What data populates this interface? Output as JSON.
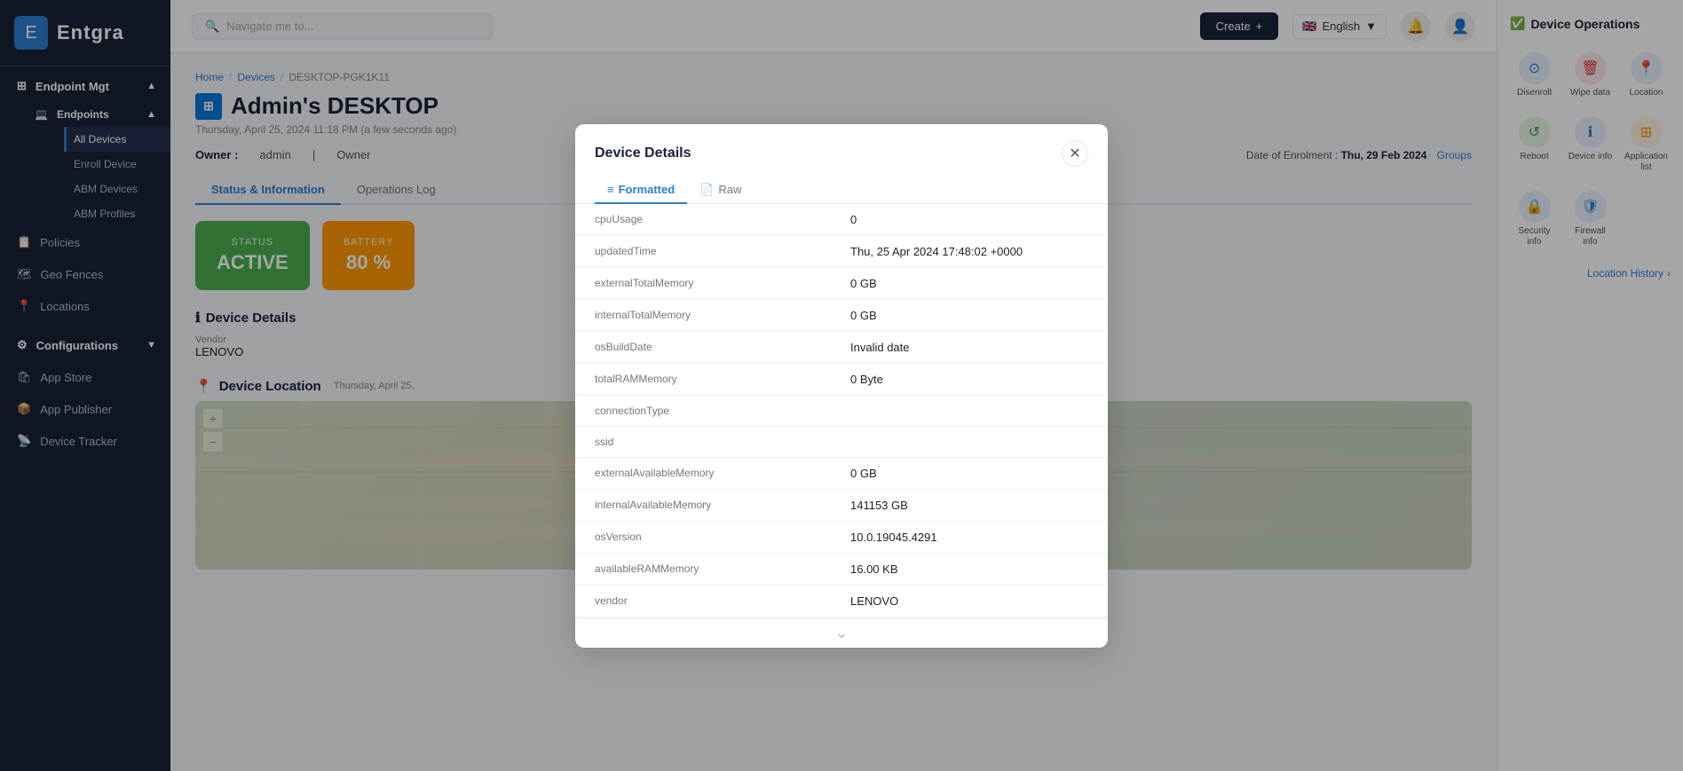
{
  "app": {
    "name": "Entgra"
  },
  "topbar": {
    "search_placeholder": "Navigate me to...",
    "create_label": "Create",
    "language": "English",
    "lang_flag": "🇬🇧"
  },
  "breadcrumb": {
    "home": "Home",
    "devices": "Devices",
    "current": "DESKTOP-PGK1K11"
  },
  "page": {
    "title": "Admin's DESKTOP",
    "subtitle": "Thursday, April 25, 2024 11:18 PM (a few seconds ago)",
    "owner_label": "Owner :",
    "owner_value": "admin",
    "owner_type_label": "Owner",
    "enroll_label": "Date of Enrolment :",
    "enroll_value": "Thu, 29 Feb 2024",
    "groups_label": "Groups"
  },
  "tabs": [
    {
      "label": "Status & Information",
      "active": true
    },
    {
      "label": "Operations Log",
      "active": false
    }
  ],
  "status_cards": [
    {
      "label": "Status",
      "value": "ACTIVE",
      "type": "active"
    },
    {
      "label": "Battery",
      "value": "80 %",
      "type": "battery"
    }
  ],
  "device_details": {
    "section_title": "Device Details",
    "fields": [
      {
        "label": "Vendor",
        "value": "LENOVO"
      }
    ]
  },
  "device_location": {
    "section_title": "Device Location",
    "timestamp": "Thursday, April 25,",
    "history_link": "Location History"
  },
  "device_operations": {
    "title": "Device Operations",
    "operations": [
      {
        "id": "disenroll",
        "label": "Disenroll",
        "icon": "⊙",
        "class": "op-disenroll"
      },
      {
        "id": "wipe",
        "label": "Wipe data",
        "icon": "🗑",
        "class": "op-wipe"
      },
      {
        "id": "location",
        "label": "Location",
        "icon": "📍",
        "class": "op-location"
      },
      {
        "id": "reboot",
        "label": "Reboot",
        "icon": "↺",
        "class": "op-reboot"
      },
      {
        "id": "devinfo",
        "label": "Device info",
        "icon": "ℹ",
        "class": "op-devinfo"
      },
      {
        "id": "applist",
        "label": "Application list",
        "icon": "⊞",
        "class": "op-applist"
      },
      {
        "id": "secinfo",
        "label": "Security info",
        "icon": "🔒",
        "class": "op-secinfo"
      },
      {
        "id": "firewall",
        "label": "Firewall info",
        "icon": "🛡",
        "class": "op-firewall"
      }
    ]
  },
  "sidebar": {
    "logo": "Entgra",
    "items": [
      {
        "id": "endpoint-mgt",
        "label": "Endpoint Mgt",
        "icon": "⊞",
        "expanded": true,
        "type": "section"
      },
      {
        "id": "endpoints",
        "label": "Endpoints",
        "icon": "💻",
        "expanded": true,
        "type": "subsection"
      },
      {
        "id": "all-devices",
        "label": "All Devices",
        "icon": "",
        "type": "sub"
      },
      {
        "id": "enroll-device",
        "label": "Enroll Device",
        "icon": "",
        "type": "sub"
      },
      {
        "id": "abm-devices",
        "label": "ABM Devices",
        "icon": "",
        "type": "sub"
      },
      {
        "id": "abm-profiles",
        "label": "ABM Profiles",
        "icon": "",
        "type": "sub"
      },
      {
        "id": "policies",
        "label": "Policies",
        "icon": "📋",
        "type": "main"
      },
      {
        "id": "geo-fences",
        "label": "Geo Fences",
        "icon": "🗺",
        "type": "main"
      },
      {
        "id": "locations",
        "label": "Locations",
        "icon": "📍",
        "type": "main"
      },
      {
        "id": "configurations",
        "label": "Configurations",
        "icon": "⚙",
        "type": "section"
      },
      {
        "id": "app-store",
        "label": "App Store",
        "icon": "🛍",
        "type": "main"
      },
      {
        "id": "app-publisher",
        "label": "App Publisher",
        "icon": "📦",
        "type": "main"
      },
      {
        "id": "device-tracker",
        "label": "Device Tracker",
        "icon": "📡",
        "type": "main"
      }
    ]
  },
  "modal": {
    "title": "Device Details",
    "tabs": [
      {
        "label": "Formatted",
        "icon": "≡",
        "active": true
      },
      {
        "label": "Raw",
        "icon": "📄",
        "active": false
      }
    ],
    "rows": [
      {
        "key": "cpuUsage",
        "value": "0"
      },
      {
        "key": "updatedTime",
        "value": "Thu, 25 Apr 2024 17:48:02 +0000"
      },
      {
        "key": "externalTotalMemory",
        "value": "0 GB"
      },
      {
        "key": "internalTotalMemory",
        "value": "0 GB"
      },
      {
        "key": "osBuildDate",
        "value": "Invalid date"
      },
      {
        "key": "totalRAMMemory",
        "value": "0 Byte"
      },
      {
        "key": "connectionType",
        "value": ""
      },
      {
        "key": "ssid",
        "value": ""
      },
      {
        "key": "externalAvailableMemory",
        "value": "0 GB"
      },
      {
        "key": "internalAvailableMemory",
        "value": "141153 GB"
      },
      {
        "key": "osVersion",
        "value": "10.0.19045.4291"
      },
      {
        "key": "availableRAMMemory",
        "value": "16.00 KB"
      },
      {
        "key": "vendor",
        "value": "LENOVO"
      }
    ]
  }
}
